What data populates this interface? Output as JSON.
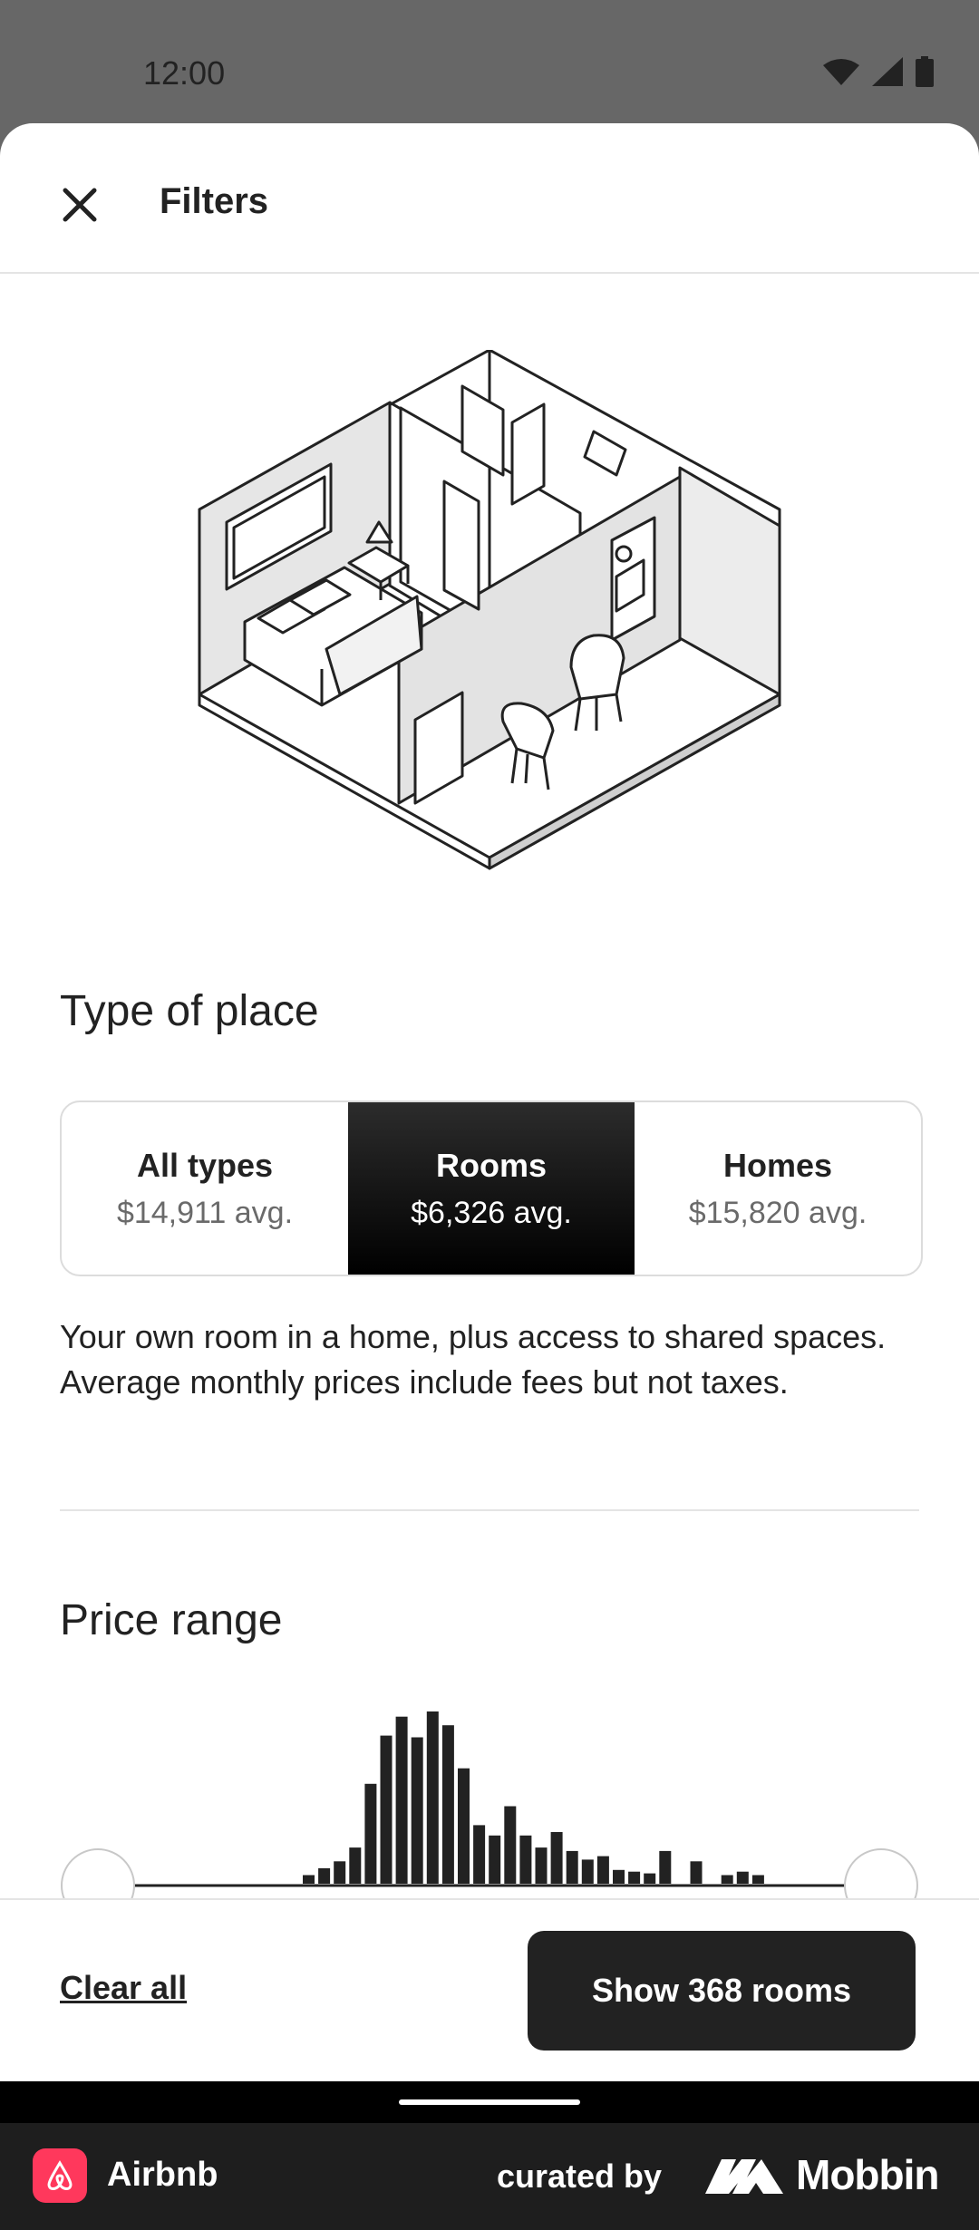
{
  "status_bar": {
    "time": "12:00",
    "icons": [
      "wifi-icon",
      "signal-icon",
      "battery-icon"
    ]
  },
  "header": {
    "title": "Filters",
    "close_icon": "close-icon"
  },
  "type_of_place": {
    "title": "Type of place",
    "options": [
      {
        "label": "All types",
        "avg": "$14,911 avg.",
        "selected": false
      },
      {
        "label": "Rooms",
        "avg": "$6,326 avg.",
        "selected": true
      },
      {
        "label": "Homes",
        "avg": "$15,820 avg.",
        "selected": false
      }
    ],
    "description": "Your own room in a home, plus access to shared spaces. Average monthly prices include fees but not taxes."
  },
  "price_range": {
    "title": "Price range",
    "histogram_levels": [
      0.05,
      0.09,
      0.13,
      0.21,
      0.58,
      0.86,
      0.97,
      0.85,
      1.0,
      0.92,
      0.67,
      0.34,
      0.28,
      0.45,
      0.28,
      0.21,
      0.3,
      0.19,
      0.14,
      0.16,
      0.08,
      0.07,
      0.06,
      0.19,
      0,
      0.13,
      0,
      0.05,
      0.07,
      0.05
    ],
    "histogram_color": "#222222"
  },
  "footer": {
    "clear_label": "Clear all",
    "show_label": "Show 368 rooms"
  },
  "attribution": {
    "app_name": "Airbnb",
    "curated_by": "curated by",
    "brand": "Mobbin"
  },
  "colors": {
    "airbnb": "#ff385c",
    "selected_bg": "#000000",
    "text": "#222222"
  }
}
